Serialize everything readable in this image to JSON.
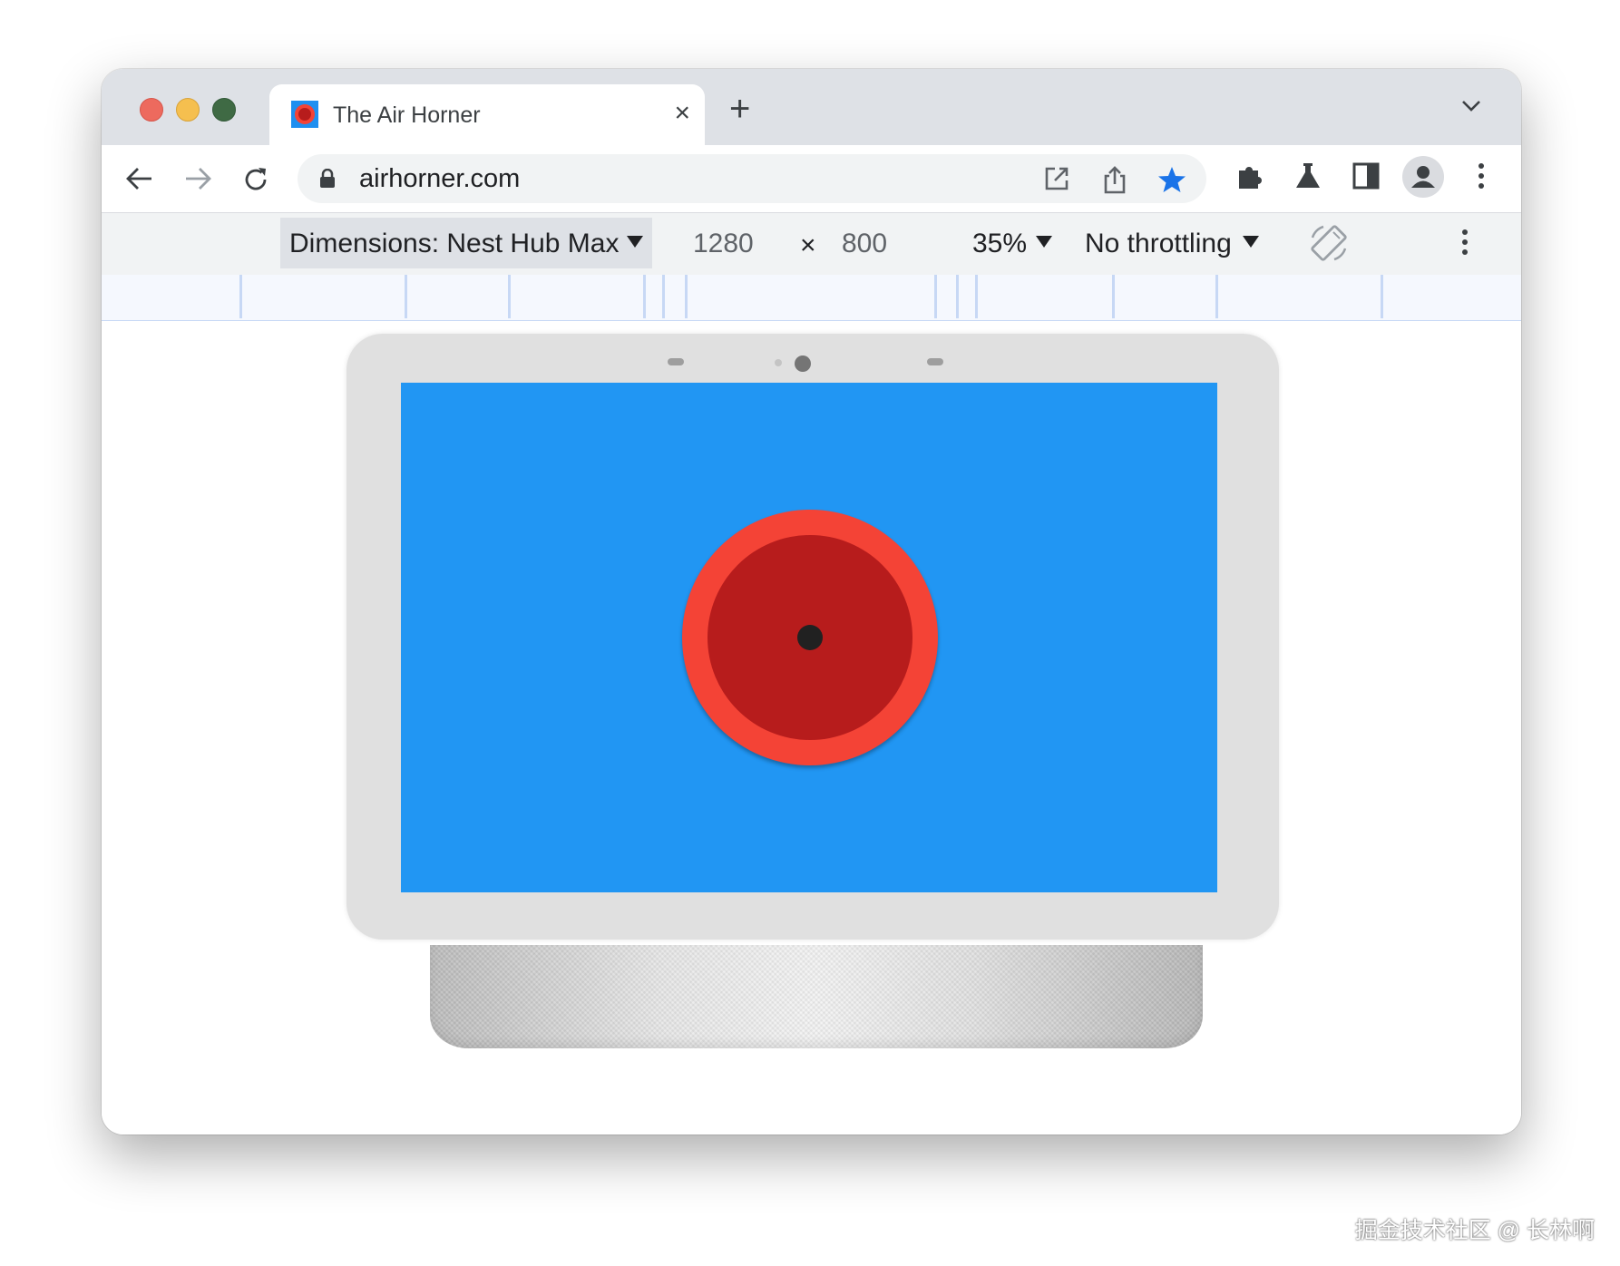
{
  "tab": {
    "title": "The Air Horner",
    "close_icon": "×",
    "new_tab_icon": "+"
  },
  "omnibox": {
    "url": "airhorner.com"
  },
  "device_toolbar": {
    "dimensions_label": "Dimensions: Nest Hub Max",
    "width": "1280",
    "times": "×",
    "height": "800",
    "zoom": "35%",
    "throttling": "No throttling"
  },
  "icons": {
    "traffic_lights": [
      "close-light",
      "minimize-light",
      "zoom-light"
    ],
    "toolbar": [
      "back-icon",
      "forward-icon",
      "reload-icon",
      "lock-icon",
      "open-in-new-icon",
      "share-icon",
      "bookmark-star-icon",
      "extensions-puzzle-icon",
      "labs-flask-icon",
      "side-panel-icon",
      "profile-avatar-icon",
      "more-vert-icon"
    ],
    "devtools": [
      "rotate-icon",
      "more-vert-icon"
    ]
  },
  "colors": {
    "screen_background": "#2196f3",
    "horn_outer": "#f44336",
    "horn_inner": "#b71c1c",
    "bookmark_star": "#1a73e8"
  },
  "watermark": "掘金技术社区 @ 长林啊"
}
